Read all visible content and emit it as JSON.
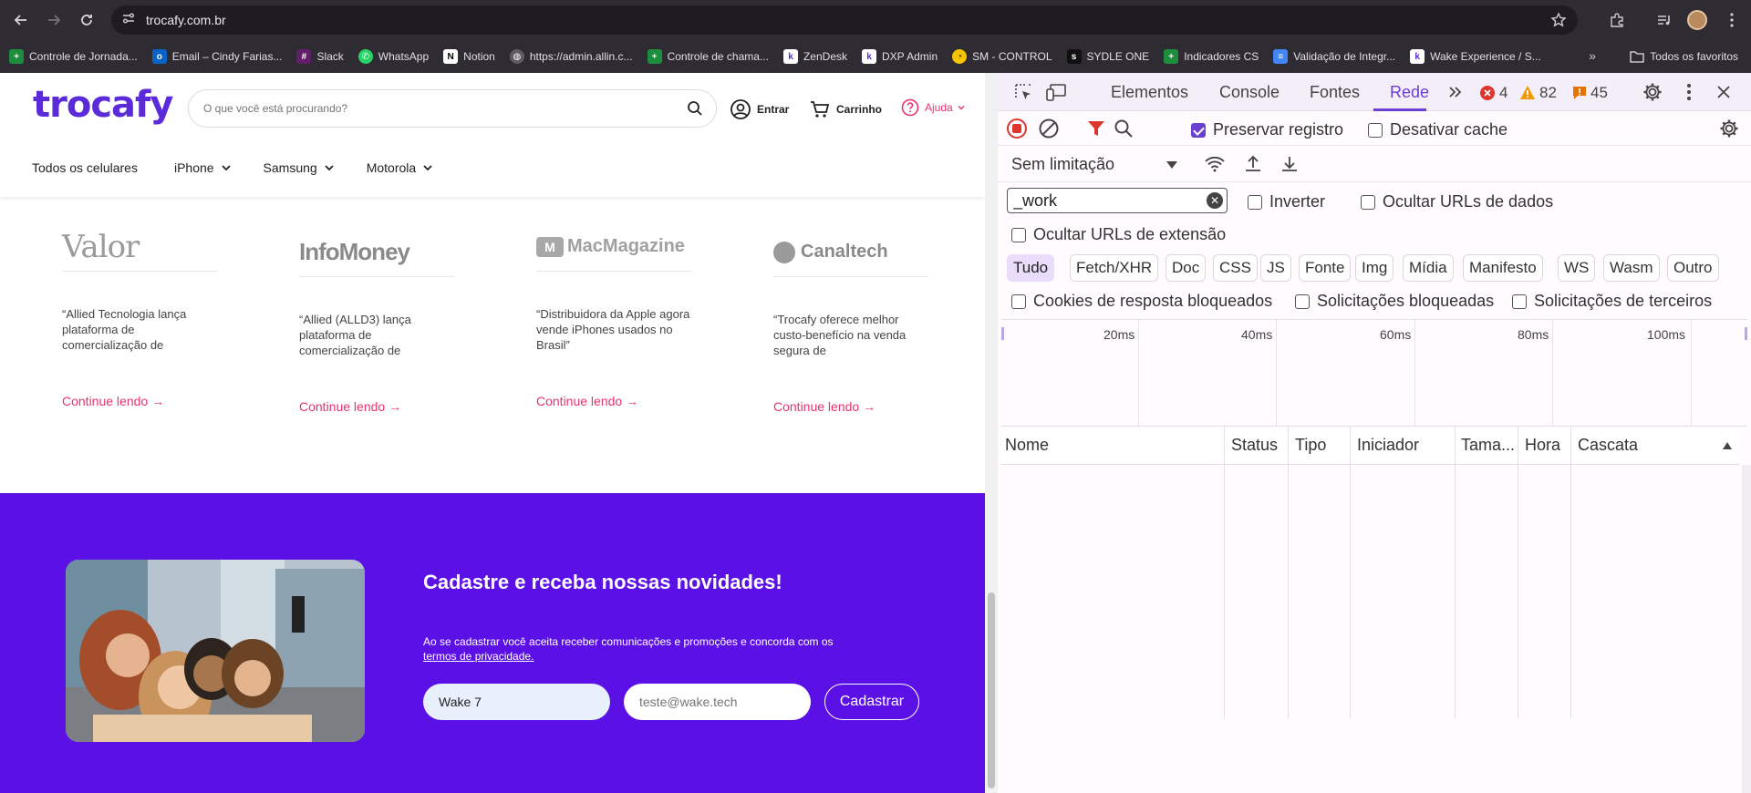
{
  "browser": {
    "url": "trocafy.com.br",
    "bookmarks": [
      {
        "label": "Controle de Jornada...",
        "icon": "sheets-icon",
        "color": "#1e8e3e"
      },
      {
        "label": "Email – Cindy Farias...",
        "icon": "outlook-icon",
        "color": "#0a64c8"
      },
      {
        "label": "Slack",
        "icon": "slack-icon",
        "color": "#611f69"
      },
      {
        "label": "WhatsApp",
        "icon": "whatsapp-icon",
        "color": "#25d366"
      },
      {
        "label": "Notion",
        "icon": "notion-icon",
        "color": "#333333"
      },
      {
        "label": "https://admin.allin.c...",
        "icon": "globe-icon",
        "color": "#777777"
      },
      {
        "label": "Controle de chama...",
        "icon": "sheets-icon",
        "color": "#1e8e3e"
      },
      {
        "label": "ZenDesk",
        "icon": "k-icon",
        "color": "#ffffff"
      },
      {
        "label": "DXP Admin",
        "icon": "k-icon",
        "color": "#ffffff"
      },
      {
        "label": "SM - CONTROL",
        "icon": "sm-icon",
        "color": "#f5c400"
      },
      {
        "label": "SYDLE ONE",
        "icon": "sydle-icon",
        "color": "#111111"
      },
      {
        "label": "Indicadores CS",
        "icon": "sheets-icon",
        "color": "#1e8e3e"
      },
      {
        "label": "Validação de Integr...",
        "icon": "docs-icon",
        "color": "#4285f4"
      },
      {
        "label": "Wake Experience / S...",
        "icon": "k-icon",
        "color": "#ffffff"
      }
    ],
    "all_bookmarks": "Todos os favoritos"
  },
  "site": {
    "logo": "trocafy",
    "search_placeholder": "O que você está procurando?",
    "login": "Entrar",
    "cart": "Carrinho",
    "help": "Ajuda",
    "nav": [
      "Todos os celulares",
      "iPhone",
      "Samsung",
      "Motorola"
    ],
    "press": [
      {
        "outlet": "Valor",
        "quote": "“Allied Tecnologia lança plataforma de comercialização de",
        "link": "Continue lendo →"
      },
      {
        "outlet": "InfoMoney",
        "quote": "“Allied (ALLD3) lança plataforma de comercialização de",
        "link": "Continue lendo →"
      },
      {
        "outlet": "MacMagazine",
        "quote": "“Distribuidora da Apple agora vende iPhones usados no Brasil”",
        "link": "Continue lendo →"
      },
      {
        "outlet": "Canaltech",
        "quote": "“Trocafy oferece melhor custo-benefício na venda segura de",
        "link": "Continue lendo →"
      }
    ],
    "newsletter": {
      "title": "Cadastre e receba nossas novidades!",
      "text": "Ao se cadastrar você aceita receber comunicações e promoções e concorda com os",
      "terms_link": "termos de privacidade.",
      "name_value": "Wake 7",
      "email_placeholder": "teste@wake.tech",
      "submit": "Cadastrar",
      "bg_color": "#5b10e6"
    }
  },
  "devtools": {
    "tabs": [
      "Elementos",
      "Console",
      "Fontes",
      "Rede"
    ],
    "active_tab": "Rede",
    "errors": "4",
    "warnings": "82",
    "issues": "45",
    "preserve_log": "Preservar registro",
    "disable_cache": "Desativar cache",
    "throttling": "Sem limitação",
    "filter_value": "_work",
    "invert": "Inverter",
    "hide_data_urls": "Ocultar URLs de dados",
    "hide_ext_urls": "Ocultar URLs de extensão",
    "types": [
      "Tudo",
      "Fetch/XHR",
      "Doc",
      "CSS",
      "JS",
      "Fonte",
      "Img",
      "Mídia",
      "Manifesto",
      "WS",
      "Wasm",
      "Outro"
    ],
    "blocked_cookies": "Cookies de resposta bloqueados",
    "blocked_requests": "Solicitações bloqueadas",
    "third_party": "Solicitações de terceiros",
    "timeline_ticks": [
      "20ms",
      "40ms",
      "60ms",
      "80ms",
      "100ms"
    ],
    "columns": [
      "Nome",
      "Status",
      "Tipo",
      "Iniciador",
      "Tama...",
      "Hora",
      "Cascata"
    ]
  }
}
